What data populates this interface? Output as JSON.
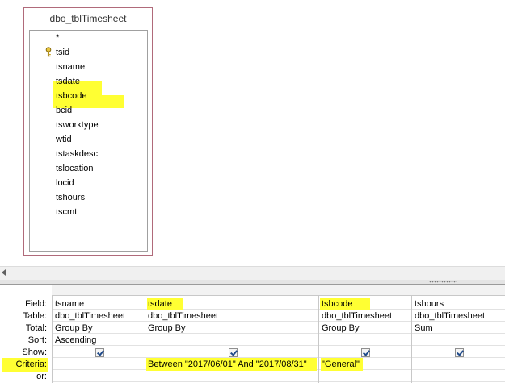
{
  "table": {
    "title": "dbo_tblTimesheet",
    "fields": [
      "*",
      "tsid",
      "tsname",
      "tsdate",
      "tsbcode",
      "bcid",
      "tsworktype",
      "wtid",
      "tstaskdesc",
      "tslocation",
      "locid",
      "tshours",
      "tscmt"
    ]
  },
  "grid": {
    "row_labels": [
      "Field:",
      "Table:",
      "Total:",
      "Sort:",
      "Show:",
      "Criteria:",
      "or:"
    ],
    "columns": [
      {
        "field": "tsname",
        "table": "dbo_tblTimesheet",
        "total": "Group By",
        "sort": "Ascending",
        "show": true,
        "criteria": ""
      },
      {
        "field": "tsdate",
        "table": "dbo_tblTimesheet",
        "total": "Group By",
        "sort": "",
        "show": true,
        "criteria": "Between \"2017/06/01\" And \"2017/08/31\""
      },
      {
        "field": "tsbcode",
        "table": "dbo_tblTimesheet",
        "total": "Group By",
        "sort": "",
        "show": true,
        "criteria": "\"General\""
      },
      {
        "field": "tshours",
        "table": "dbo_tblTimesheet",
        "total": "Sum",
        "sort": "",
        "show": true,
        "criteria": ""
      }
    ]
  },
  "colors": {
    "highlight": "#ffff33",
    "table_border": "#b06a7a"
  }
}
